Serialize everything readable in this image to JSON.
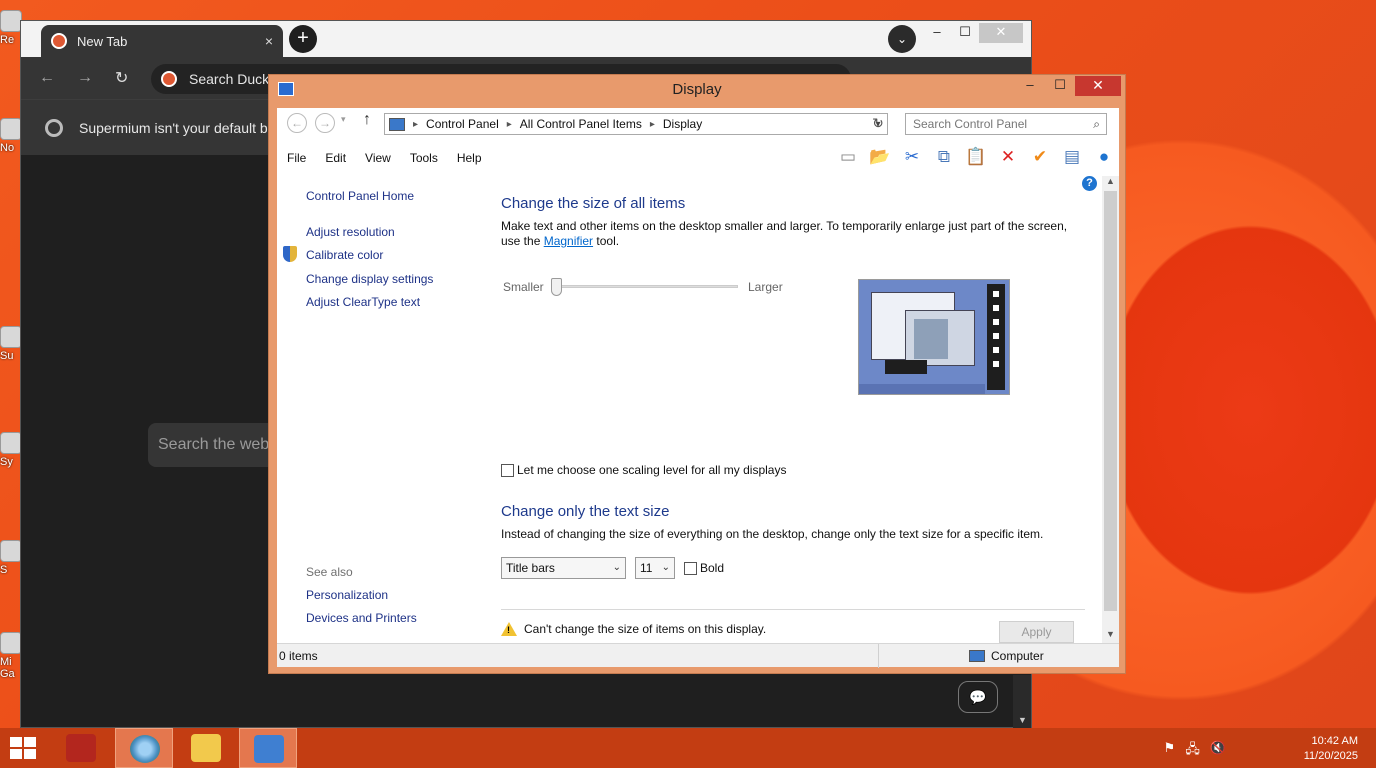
{
  "desktop": {
    "icons": [
      {
        "label": "Re"
      },
      {
        "label": "No"
      },
      {
        "label": "Su"
      },
      {
        "label": "Sy"
      },
      {
        "label": "S"
      },
      {
        "label": "Mi Ga"
      }
    ]
  },
  "browser": {
    "tab_title": "New Tab",
    "tab_close": "×",
    "new_tab": "+",
    "omnibox_text": "Search DuckDuckGo or type a URL",
    "infobar_text": "Supermium isn't your default browser",
    "page_search_placeholder": "Search the web",
    "window_controls": {
      "menu": "⌄",
      "minimize": "–",
      "maximize": "☐",
      "close": "✕"
    }
  },
  "control_panel": {
    "title": "Display",
    "window_controls": {
      "minimize": "–",
      "maximize": "☐",
      "close": "✕"
    },
    "breadcrumb": [
      "Control Panel",
      "All Control Panel Items",
      "Display"
    ],
    "search_placeholder": "Search Control Panel",
    "menu": [
      "File",
      "Edit",
      "View",
      "Tools",
      "Help"
    ],
    "sidebar": {
      "home": "Control Panel Home",
      "links": [
        "Adjust resolution",
        "Calibrate color",
        "Change display settings",
        "Adjust ClearType text"
      ],
      "see_also_heading": "See also",
      "see_also": [
        "Personalization",
        "Devices and Printers"
      ]
    },
    "section1": {
      "heading": "Change the size of all items",
      "desc_before_link": "Make text and other items on the desktop smaller and larger. To temporarily enlarge just part of the screen, use the ",
      "link": "Magnifier",
      "desc_after_link": " tool.",
      "slider_min_label": "Smaller",
      "slider_max_label": "Larger",
      "slider_position": 0
    },
    "scaling_checkbox_label": "Let me choose one scaling level for all my displays",
    "scaling_checkbox_checked": false,
    "section2": {
      "heading": "Change only the text size",
      "desc": "Instead of changing the size of everything on the desktop, change only the text size for a specific item.",
      "item_select": "Title bars",
      "size_select": "11",
      "bold_label": "Bold",
      "bold_checked": false
    },
    "warning": "Can't change the size of items on this display.",
    "apply_label": "Apply",
    "status_items": "0 items",
    "status_location": "Computer"
  },
  "taskbar": {
    "clock_time": "10:42 AM",
    "clock_date": "11/20/2025"
  },
  "colors": {
    "desktop_accent": "#e8501a",
    "window_frame": "#e89a6c",
    "close_red": "#c7372f",
    "link_blue": "#1e3287",
    "heading_blue": "#1e3a8c",
    "taskbar": "#c33d12"
  }
}
